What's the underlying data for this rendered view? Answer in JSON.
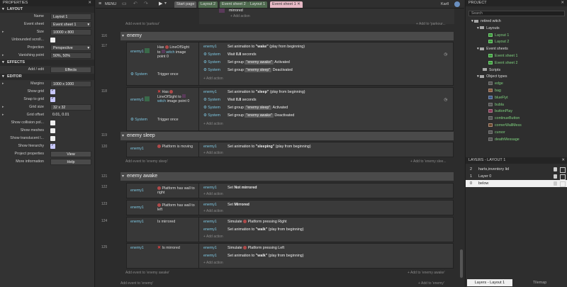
{
  "left": {
    "title": "PROPERTIES",
    "sections": {
      "layout": "LAYOUT",
      "effects": "EFFECTS",
      "editor": "EDITOR"
    },
    "layout_rows": [
      [
        "Name",
        "Layout 1"
      ],
      [
        "Event sheet",
        "Event sheet 1"
      ],
      [
        "Size",
        "10000 x 800"
      ],
      [
        "Unbounded scroll...",
        ""
      ],
      [
        "Projection",
        "Perspective"
      ],
      [
        "Vanishing point",
        "50%, 50%"
      ]
    ],
    "effects_label": "Add / edit",
    "effects_btn": "Effects",
    "editor_rows": [
      [
        "Margins",
        "1000 x 1000"
      ],
      [
        "Show grid",
        ""
      ],
      [
        "Snap to grid",
        ""
      ],
      [
        "Grid size",
        "32 x 32"
      ],
      [
        "Grid offset",
        "0.01, 0.01"
      ],
      [
        "Show collision pol...",
        ""
      ],
      [
        "Show meshes",
        ""
      ],
      [
        "Show translucent l...",
        ""
      ],
      [
        "Show hierarchy",
        ""
      ]
    ],
    "project_props": "Project properties",
    "project_btn": "View",
    "more_info": "More information",
    "help_btn": "Help"
  },
  "top": {
    "menu": "MENU",
    "tabs": [
      "Start page",
      "Layout 2",
      "Event sheet 2",
      "Layout 1",
      "Event sheet 1"
    ],
    "user": "Karll"
  },
  "sheet": {
    "top_mirrored": "mirrored",
    "top_add_event": "Add event to 'parkour'",
    "top_add_to": "+ Add to 'parkour...",
    "g1": {
      "num": "116",
      "name": "enemy"
    },
    "e117": {
      "num": "117",
      "obj": "enemy1",
      "has": "Has",
      "los": "LineOfSight",
      "to": "to",
      "witch": "witch",
      "img": "image",
      "pt": "point 0",
      "sys": "System",
      "trig": "Trigger once",
      "a": [
        [
          "enemy1",
          "Set animation to ",
          "\"wake\"",
          "(play from beginning)"
        ],
        [
          "System",
          "Wait ",
          "0.8",
          "seconds"
        ],
        [
          "System",
          "Set group ",
          "\"enemy awake\"",
          "Activated"
        ],
        [
          "System",
          "Set group ",
          "\"enemy sleep\"",
          "Deactivated"
        ]
      ],
      "add": "+ Add action"
    },
    "e118": {
      "num": "118",
      "obj": "enemy1",
      "has": "Has",
      "los": "LineOfSight to",
      "witch": "witch",
      "img": "image point 0",
      "sys": "System",
      "trig": "Trigger once",
      "a": [
        [
          "enemy1",
          "Set animation to ",
          "\"sleep\"",
          "(play from beginning)"
        ],
        [
          "System",
          "Wait ",
          "0.8",
          "seconds"
        ],
        [
          "System",
          "Set group ",
          "\"enemy sleep\"",
          "Activated"
        ],
        [
          "System",
          "Set group ",
          "\"enemy awake\"",
          "Deactivated"
        ]
      ],
      "add": "+ Add action"
    },
    "g2": {
      "num": "119",
      "name": "enemy sleep"
    },
    "e120": {
      "num": "120",
      "obj": "enemy1",
      "cond": "Platform is moving",
      "a": [
        "enemy1",
        "Set animation to ",
        "\"sleeping\"",
        "(play from beginning)"
      ],
      "add": "+ Add action",
      "add_ev": "Add event to 'enemy sleep'",
      "add_to": "+ Add to 'enemy slee..."
    },
    "g3": {
      "num": "121",
      "name": "enemy awake"
    },
    "e122": {
      "num": "122",
      "obj": "enemy1",
      "cond": "Platform has wall to right",
      "a": [
        "enemy1",
        "Set ",
        "Not mirrored",
        ""
      ],
      "add": "+ Add action"
    },
    "e123": {
      "num": "123",
      "obj": "enemy1",
      "cond": "Platform has wall to left",
      "a": [
        "enemy1",
        "Set ",
        "Mirrored",
        ""
      ],
      "add": "+ Add action"
    },
    "e124": {
      "num": "124",
      "obj": "enemy1",
      "cond": "Is mirrored",
      "a": [
        [
          "enemy1",
          "Simulate ",
          "Platform pressing Right"
        ],
        [
          "enemy1",
          "Set animation to ",
          "\"walk\"",
          "(play from beginning)"
        ]
      ],
      "add": "+ Add action"
    },
    "e125": {
      "num": "125",
      "obj": "enemy1",
      "cond": "Is mirrored",
      "a": [
        [
          "enemy1",
          "Simulate ",
          "Platform pressing Left"
        ],
        [
          "enemy1",
          "Set animation to ",
          "\"walk\"",
          "(play from beginning)"
        ]
      ],
      "add": "+ Add action"
    },
    "add_awake": "Add event to 'enemy awake'",
    "add_awake_to": "+ Add to 'enemy awake'",
    "add_enemy": "Add event to 'enemy'",
    "add_enemy_to": "+ Add to 'enemy'"
  },
  "right": {
    "title": "PROJECT",
    "search": "Search",
    "tree": [
      "retired witch",
      "Layouts",
      "Layout 1",
      "Layout 2",
      "Event sheets",
      "Event sheet 1",
      "Event sheet 2",
      "Scripts",
      "Object types",
      "edge",
      "bag",
      "blueFlyt",
      "bubla",
      "buttonPlay",
      "continueButton",
      "cornerWallMess",
      "cursor",
      "deathMessage"
    ],
    "layers_title": "LAYERS - LAYOUT 1",
    "layers": [
      [
        "2",
        "harts,inventory lid"
      ],
      [
        "1",
        "Layer 0"
      ],
      [
        "0",
        "below"
      ]
    ],
    "tab1": "Layers - Layout 1",
    "tab2": "Tilemap"
  }
}
